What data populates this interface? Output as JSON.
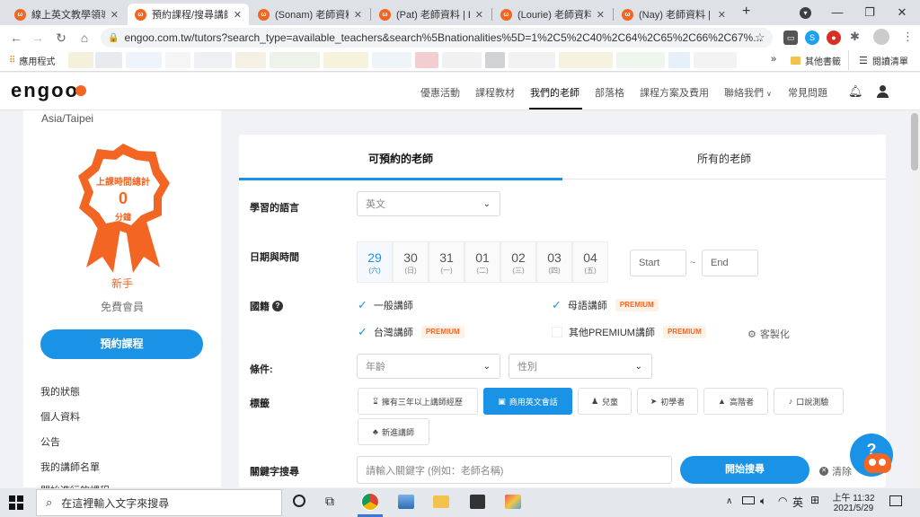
{
  "browser": {
    "tabs": [
      {
        "title": "線上英文教學領導品"
      },
      {
        "title": "預約課程/搜尋講師"
      },
      {
        "title": "(Sonam) 老師資料 | E"
      },
      {
        "title": "(Pat) 老師資料 | Eng"
      },
      {
        "title": "(Lourie) 老師資料 |"
      },
      {
        "title": "(Nay) 老師資料 | En"
      }
    ],
    "url": "engoo.com.tw/tutors?search_type=available_teachers&search%5Bnationalities%5D=1%2C5%2C40%2C64%2C65%2C66%2C67%...",
    "bookmarks_apps": "應用程式",
    "bookmarks_other": "其他書籤",
    "reading_list": "閱讀清單"
  },
  "site": {
    "logo": "engoo",
    "nav": [
      "優惠活動",
      "課程教材",
      "我們的老師",
      "部落格",
      "課程方案及費用",
      "聯絡我們",
      "常見問題"
    ],
    "nav_active_index": 2
  },
  "sidebar": {
    "timezone": "Asia/Taipei",
    "badge_title": "上課時間總計",
    "badge_value": "0",
    "badge_unit": "分鐘",
    "rank": "新手",
    "membership": "免費會員",
    "book_button": "預約課程",
    "links": [
      "我的狀態",
      "個人資料",
      "公告",
      "我的講師名單",
      "開始進行的課程"
    ]
  },
  "search": {
    "tabs": [
      "可預約的老師",
      "所有的老師"
    ],
    "active_tab": 0,
    "language_label": "學習的語言",
    "language_value": "英文",
    "datetime_label": "日期與時間",
    "dates": [
      {
        "num": "29",
        "day": "(六)"
      },
      {
        "num": "30",
        "day": "(日)"
      },
      {
        "num": "31",
        "day": "(一)"
      },
      {
        "num": "01",
        "day": "(二)"
      },
      {
        "num": "02",
        "day": "(三)"
      },
      {
        "num": "03",
        "day": "(四)"
      },
      {
        "num": "04",
        "day": "(五)"
      }
    ],
    "start_placeholder": "Start",
    "end_placeholder": "End",
    "time_sep": "~",
    "nationality_label": "國籍",
    "nationality_options": [
      {
        "label": "一般講師",
        "checked": true,
        "premium": ""
      },
      {
        "label": "母語講師",
        "checked": true,
        "premium": "PREMIUM"
      },
      {
        "label": "台灣講師",
        "checked": true,
        "premium": "PREMIUM"
      },
      {
        "label": "其他PREMIUM講師",
        "checked": false,
        "premium": "PREMIUM"
      }
    ],
    "customize": "客製化",
    "conditions_label": "條件:",
    "age_placeholder": "年齡",
    "gender_placeholder": "性別",
    "tags_label": "標籤",
    "tags": [
      {
        "label": "擁有三年以上講師經歷",
        "icon": "hourglass-icon",
        "selected": false
      },
      {
        "label": "商用英文會話",
        "icon": "briefcase-icon",
        "selected": true
      },
      {
        "label": "兒童",
        "icon": "child-icon",
        "selected": false
      },
      {
        "label": "初學者",
        "icon": "paper-plane-icon",
        "selected": false
      },
      {
        "label": "高階者",
        "icon": "graduation-cap-icon",
        "selected": false
      },
      {
        "label": "口說測驗",
        "icon": "microphone-icon",
        "selected": false
      },
      {
        "label": "新進講師",
        "icon": "sprout-icon",
        "selected": false
      }
    ],
    "keyword_label": "關鍵字搜尋",
    "keyword_placeholder": "請輸入關鍵字 (例如：老師名稱)",
    "search_button": "開始搜尋",
    "clear": "清除",
    "help": "?"
  },
  "taskbar": {
    "search_placeholder": "在這裡輸入文字來搜尋",
    "ime": "英",
    "time": "上午 11:32",
    "date": "2021/5/29"
  },
  "colors": {
    "brand": "#f26522",
    "primary": "#1a93e6"
  }
}
